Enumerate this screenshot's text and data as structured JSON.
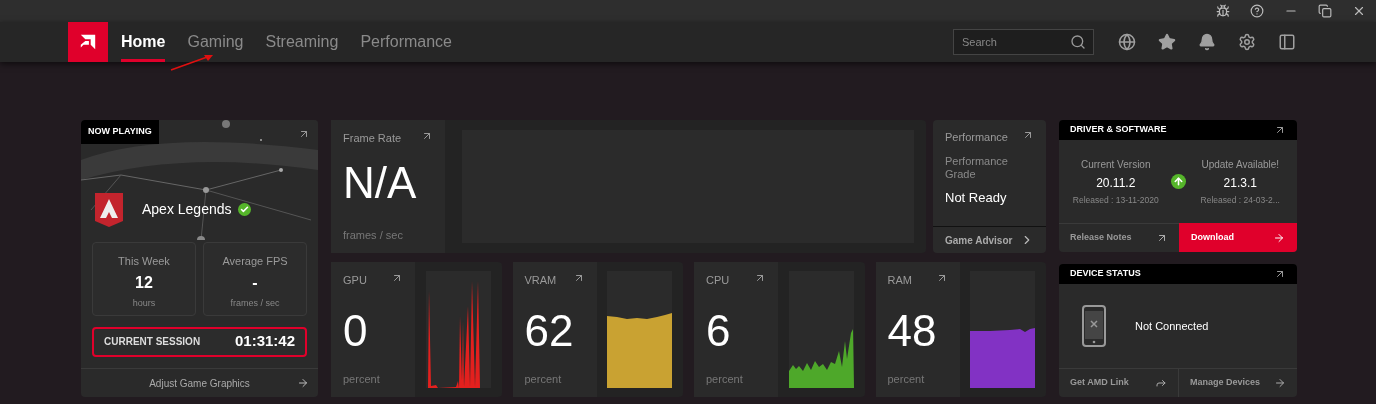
{
  "nav": {
    "tabs": [
      {
        "label": "Home",
        "selected": true
      },
      {
        "label": "Gaming",
        "selected": false
      },
      {
        "label": "Streaming",
        "selected": false
      },
      {
        "label": "Performance",
        "selected": false
      }
    ],
    "search": {
      "placeholder": "Search"
    }
  },
  "now_playing": {
    "title": "NOW PLAYING",
    "game": "Apex Legends",
    "verified": true,
    "stats": [
      {
        "label": "This Week",
        "value": "12",
        "unit": "hours"
      },
      {
        "label": "Average FPS",
        "value": "-",
        "unit": "frames / sec"
      }
    ],
    "session": {
      "label": "CURRENT SESSION",
      "time": "01:31:42"
    },
    "footer": "Adjust Game Graphics"
  },
  "frame_rate": {
    "title": "Frame Rate",
    "value": "N/A",
    "unit": "frames / sec"
  },
  "performance": {
    "title": "Performance",
    "grade_label": "Performance Grade",
    "grade": "Not Ready",
    "footer": "Game Advisor"
  },
  "metrics": [
    {
      "label": "GPU",
      "value": "0",
      "unit": "percent",
      "color": "#e3201e"
    },
    {
      "label": "VRAM",
      "value": "62",
      "unit": "percent",
      "color": "#c9a232"
    },
    {
      "label": "CPU",
      "value": "6",
      "unit": "percent",
      "color": "#4ea82a"
    },
    {
      "label": "RAM",
      "value": "48",
      "unit": "percent",
      "color": "#8232c4"
    }
  ],
  "driver": {
    "title": "DRIVER & SOFTWARE",
    "current": {
      "label": "Current Version",
      "version": "20.11.2",
      "released": "Released : 13-11-2020"
    },
    "update": {
      "label": "Update Available!",
      "version": "21.3.1",
      "released": "Released : 24-03-2..."
    },
    "release_notes": "Release Notes",
    "download": "Download"
  },
  "device": {
    "title": "DEVICE STATUS",
    "status": "Not Connected",
    "link": "Get AMD Link",
    "manage": "Manage Devices"
  }
}
